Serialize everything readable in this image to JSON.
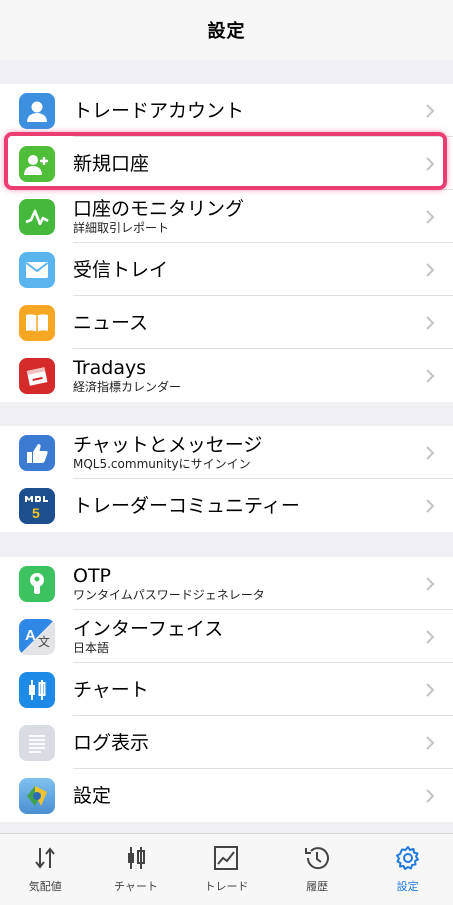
{
  "header": {
    "title": "設定"
  },
  "groups": [
    {
      "items": [
        {
          "label": "トレードアカウント",
          "icon": "account-icon"
        },
        {
          "label": "新規口座",
          "icon": "add-user-icon"
        },
        {
          "label": "口座のモニタリング",
          "sub": "詳細取引レポート",
          "icon": "monitoring-icon"
        },
        {
          "label": "受信トレイ",
          "icon": "mail-icon"
        },
        {
          "label": "ニュース",
          "icon": "news-icon"
        },
        {
          "label": "Tradays",
          "sub": "経済指標カレンダー",
          "icon": "calendar-icon"
        }
      ]
    },
    {
      "items": [
        {
          "label": "チャットとメッセージ",
          "sub": "MQL5.communityにサインイン",
          "icon": "chat-icon"
        },
        {
          "label": "トレーダーコミュニティー",
          "icon": "mql5-icon"
        }
      ]
    },
    {
      "items": [
        {
          "label": "OTP",
          "sub": "ワンタイムパスワードジェネレータ",
          "icon": "otp-icon"
        },
        {
          "label": "インターフェイス",
          "sub": "日本語",
          "icon": "language-icon"
        },
        {
          "label": "チャート",
          "icon": "candles-icon"
        },
        {
          "label": "ログ表示",
          "icon": "log-icon"
        },
        {
          "label": "設定",
          "icon": "settings-app-icon"
        }
      ]
    }
  ],
  "tabs": [
    {
      "label": "気配値",
      "icon": "quotes-icon"
    },
    {
      "label": "チャート",
      "icon": "chart-icon"
    },
    {
      "label": "トレード",
      "icon": "trade-icon"
    },
    {
      "label": "履歴",
      "icon": "history-icon"
    },
    {
      "label": "設定",
      "icon": "gear-icon",
      "active": true
    }
  ],
  "colors": {
    "accent": "#1f7ae0",
    "highlight": "#ec3d72"
  }
}
